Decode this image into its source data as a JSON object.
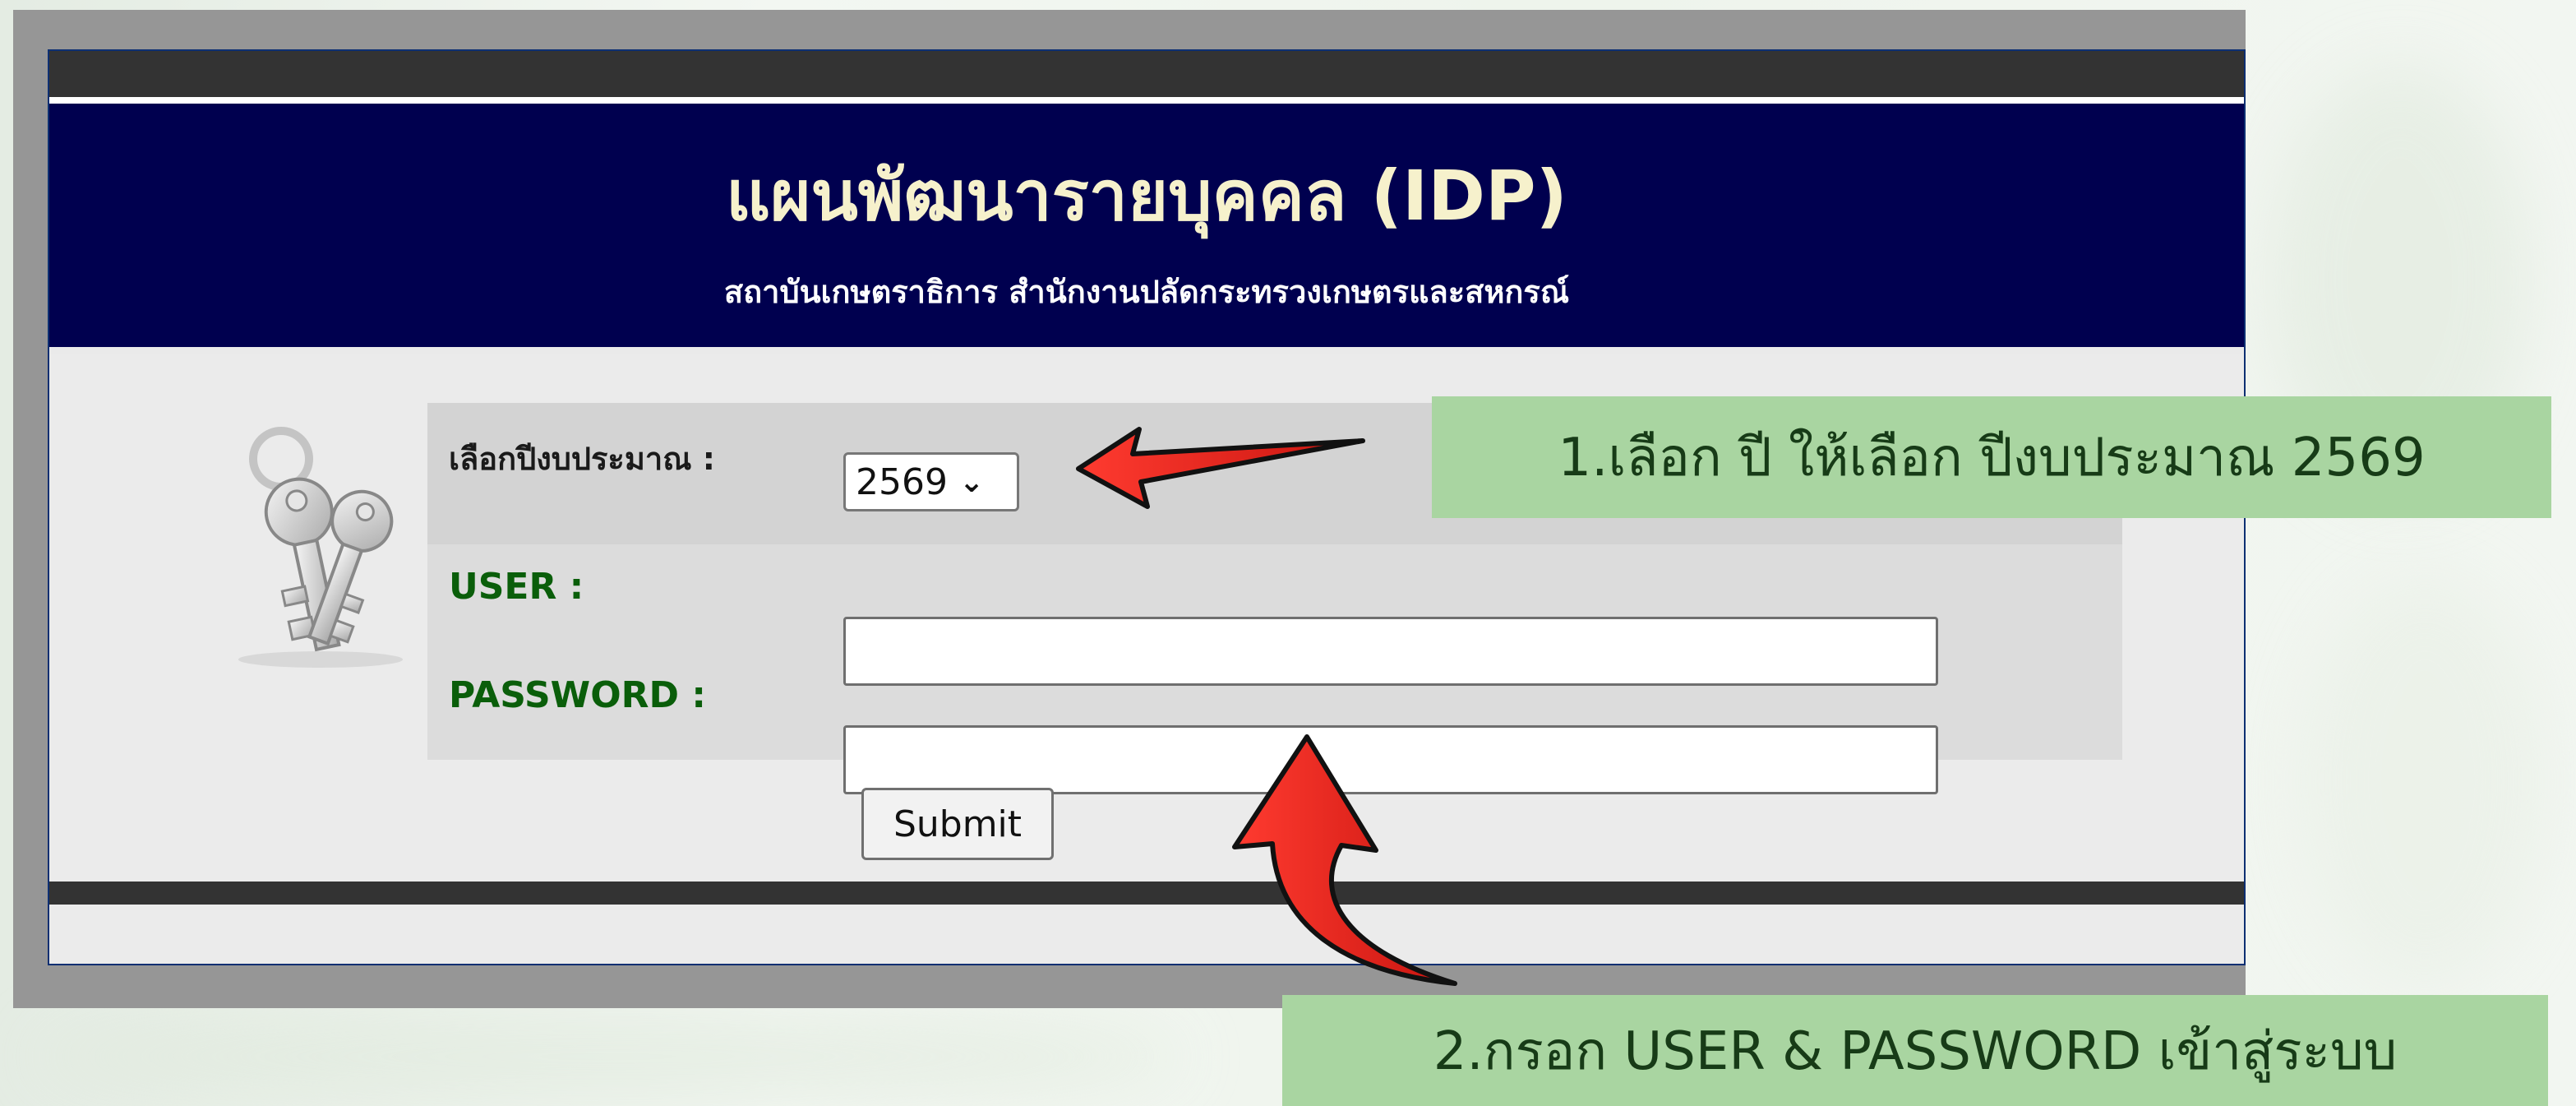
{
  "header": {
    "title": "แผนพัฒนารายบุคคล (IDP)",
    "subtitle": "สถาบันเกษตราธิการ สำนักงานปลัดกระทรวงเกษตรและสหกรณ์"
  },
  "form": {
    "year_label": "เลือกปีงบประมาณ :",
    "year_value": "2569",
    "user_label": "USER :",
    "user_value": "",
    "password_label": "PASSWORD :",
    "password_value": "",
    "submit_label": "Submit"
  },
  "annotations": {
    "step1": "1.เลือก ปี ให้เลือก ปีงบประมาณ 2569",
    "step2": "2.กรอก USER & PASSWORD เข้าสู่ระบบ"
  },
  "icons": {
    "keys": "keys-icon",
    "chevron": "chevron-down-icon",
    "arrow1": "red-arrow-left-icon",
    "arrow2": "red-curved-arrow-up-icon"
  },
  "colors": {
    "header_bg": "#00004f",
    "title_text": "#f6f1cc",
    "label_green": "#0a5e0a",
    "annotation_bg": "#a9d5a1",
    "arrow_red": "#e0231e"
  }
}
